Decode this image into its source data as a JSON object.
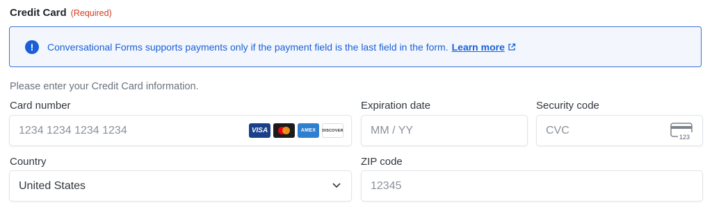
{
  "section": {
    "title": "Credit Card",
    "required": "(Required)"
  },
  "notice": {
    "icon": "info-icon",
    "message": "Conversational Forms supports payments only if the payment field is the last field in the form.",
    "link": "Learn more",
    "link_icon": "external-link-icon",
    "accent": "#1a5fd6"
  },
  "helper": "Please enter your Credit Card information.",
  "card_number": {
    "label": "Card number",
    "placeholder": "1234 1234 1234 1234",
    "brands": [
      "VISA",
      "Mastercard",
      "AMEX",
      "DISCOVER"
    ]
  },
  "expiration": {
    "label": "Expiration date",
    "placeholder": "MM / YY"
  },
  "security": {
    "label": "Security code",
    "placeholder": "CVC",
    "icon_text": "123"
  },
  "country": {
    "label": "Country",
    "value": "United States"
  },
  "zip": {
    "label": "ZIP code",
    "placeholder": "12345"
  }
}
